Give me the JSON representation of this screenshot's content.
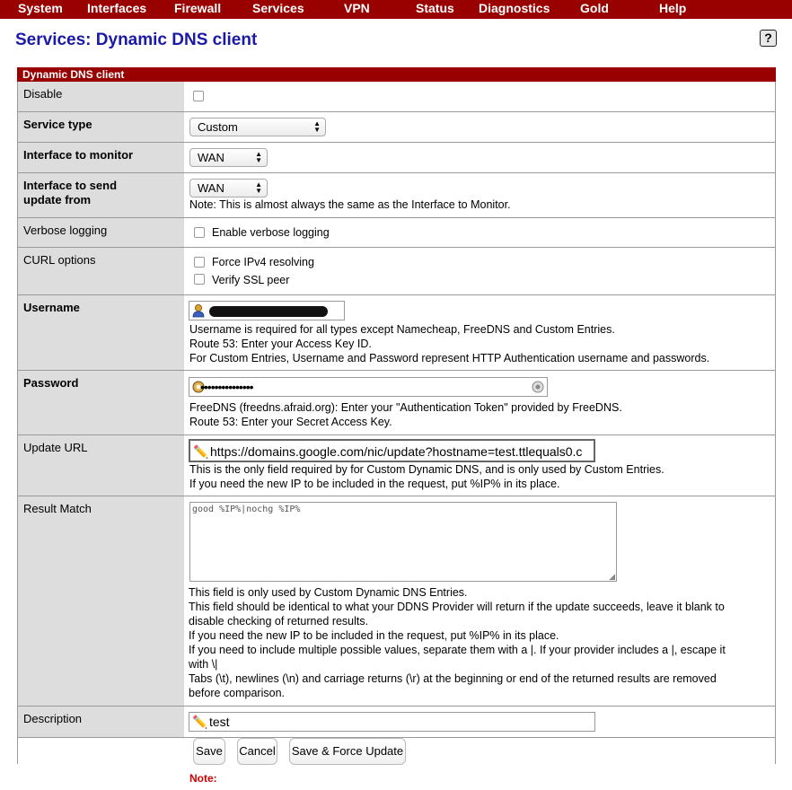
{
  "nav": {
    "items": [
      "System",
      "Interfaces",
      "Firewall",
      "Services",
      "VPN",
      "Status",
      "Diagnostics",
      "Gold",
      "Help"
    ]
  },
  "page": {
    "title": "Services: Dynamic DNS client",
    "help_glyph": "?"
  },
  "section": {
    "header": "Dynamic DNS client"
  },
  "form": {
    "disable": {
      "label": "Disable",
      "checked": false
    },
    "service_type": {
      "label": "Service type",
      "value": "Custom"
    },
    "interface_monitor": {
      "label": "Interface to monitor",
      "value": "WAN"
    },
    "interface_send": {
      "label_line1": "Interface to send",
      "label_line2": "update from",
      "value": "WAN",
      "note": "Note: This is almost always the same as the Interface to Monitor."
    },
    "verbose": {
      "label": "Verbose logging",
      "option": "Enable verbose logging",
      "checked": false
    },
    "curl": {
      "label": "CURL options",
      "option1": "Force IPv4 resolving",
      "option2": "Verify SSL peer"
    },
    "username": {
      "label": "Username",
      "note1": "Username is required for all types except Namecheap, FreeDNS and Custom Entries.",
      "note2": "Route 53: Enter your Access Key ID.",
      "note3": "For Custom Entries, Username and Password represent HTTP Authentication username and passwords."
    },
    "password": {
      "label": "Password",
      "value": "•••••••••••••••",
      "note1": "FreeDNS (freedns.afraid.org): Enter your \"Authentication Token\" provided by FreeDNS.",
      "note2": "Route 53: Enter your Secret Access Key."
    },
    "update_url": {
      "label": "Update URL",
      "value": "https://domains.google.com/nic/update?hostname=test.ttlequals0.c",
      "note1": "This is the only field required by for Custom Dynamic DNS, and is only used by Custom Entries.",
      "note2": "If you need the new IP to be included in the request, put %IP% in its place."
    },
    "result_match": {
      "label": "Result Match",
      "value": "good %IP%|nochg %IP%",
      "note1": "This field is only used by Custom Dynamic DNS Entries.",
      "note2": "This field should be identical to what your DDNS Provider will return if the update succeeds, leave it blank to",
      "note3": "disable checking of returned results.",
      "note4": "If you need the new IP to be included in the request, put %IP% in its place.",
      "note5": "If you need to include multiple possible values, separate them with a |. If your provider includes a |, escape it",
      "note6": "with \\|",
      "note7": "Tabs (\\t), newlines (\\n) and carriage returns (\\r) at the beginning or end of the returned results are removed",
      "note8": "before comparison."
    },
    "description": {
      "label": "Description",
      "value": "test"
    }
  },
  "buttons": {
    "save": "Save",
    "cancel": "Cancel",
    "force": "Save & Force Update"
  },
  "footer": {
    "note_label": "Note:"
  },
  "colors": {
    "brand": "#990000",
    "title": "#1a1aa6",
    "label_bg": "#dddddd"
  }
}
